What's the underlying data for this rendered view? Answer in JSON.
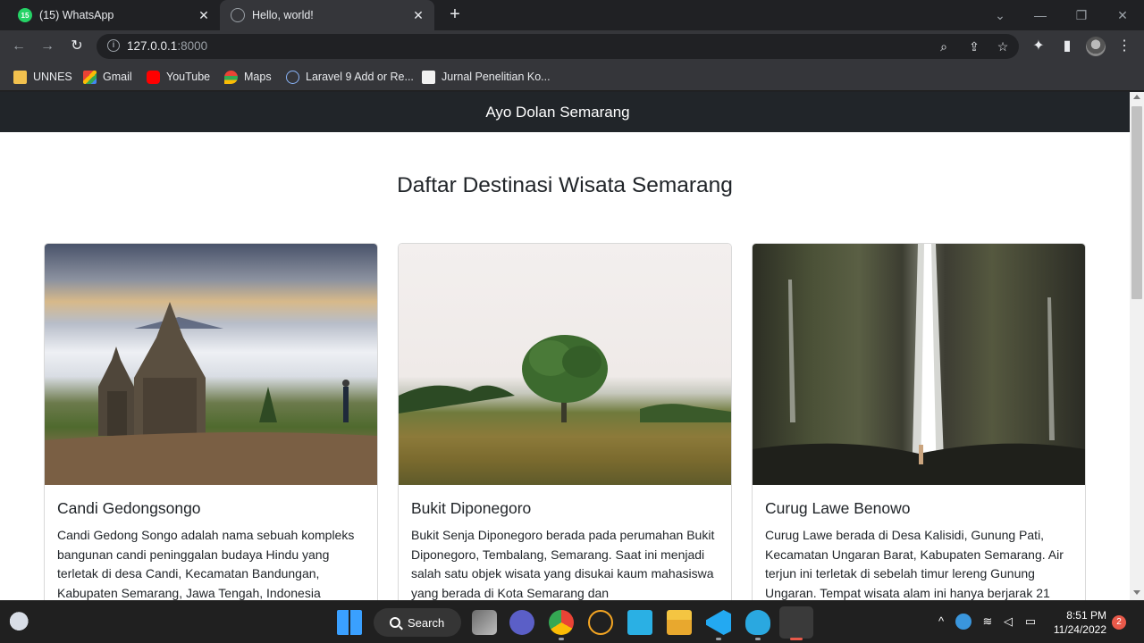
{
  "browser": {
    "tabs": [
      {
        "title": "(15) WhatsApp",
        "badge": "15",
        "active": false
      },
      {
        "title": "Hello, world!",
        "active": true
      }
    ],
    "url": {
      "host": "127.0.0.1",
      "port": ":8000"
    },
    "bookmarks": [
      {
        "label": "UNNES",
        "icon": "folder-icon"
      },
      {
        "label": "Gmail",
        "icon": "gmail-icon"
      },
      {
        "label": "YouTube",
        "icon": "youtube-icon"
      },
      {
        "label": "Maps",
        "icon": "maps-icon"
      },
      {
        "label": "Laravel 9 Add or Re...",
        "icon": "react-icon"
      },
      {
        "label": "Jurnal Penelitian Ko...",
        "icon": "pkp-icon"
      }
    ]
  },
  "site": {
    "brand": "Ayo Dolan Semarang",
    "heading": "Daftar Destinasi Wisata Semarang",
    "destinations": [
      {
        "title": "Candi Gedongsongo",
        "description": "Candi Gedong Songo adalah nama sebuah kompleks bangunan candi peninggalan budaya Hindu yang terletak di desa Candi, Kecamatan Bandungan, Kabupaten Semarang, Jawa Tengah, Indonesia"
      },
      {
        "title": "Bukit Diponegoro",
        "description": "Bukit Senja Diponegoro berada pada perumahan Bukit Diponegoro, Tembalang, Semarang. Saat ini menjadi salah satu objek wisata yang disukai kaum mahasiswa yang berada di Kota Semarang dan"
      },
      {
        "title": "Curug Lawe Benowo",
        "description": "Curug Lawe berada di Desa Kalisidi, Gunung Pati, Kecamatan Ungaran Barat, Kabupaten Semarang. Air terjun ini terletak di sebelah timur lereng Gunung Ungaran. Tempat wisata alam ini hanya berjarak 21"
      }
    ]
  },
  "taskbar": {
    "search_label": "Search",
    "time": "8:51 PM",
    "date": "11/24/2022",
    "notification_count": "2"
  },
  "colors": {
    "navbar": "#212529",
    "chrome_dark": "#202124",
    "chrome_toolbar": "#35363a",
    "whatsapp": "#25d366",
    "youtube": "#ff0000"
  }
}
